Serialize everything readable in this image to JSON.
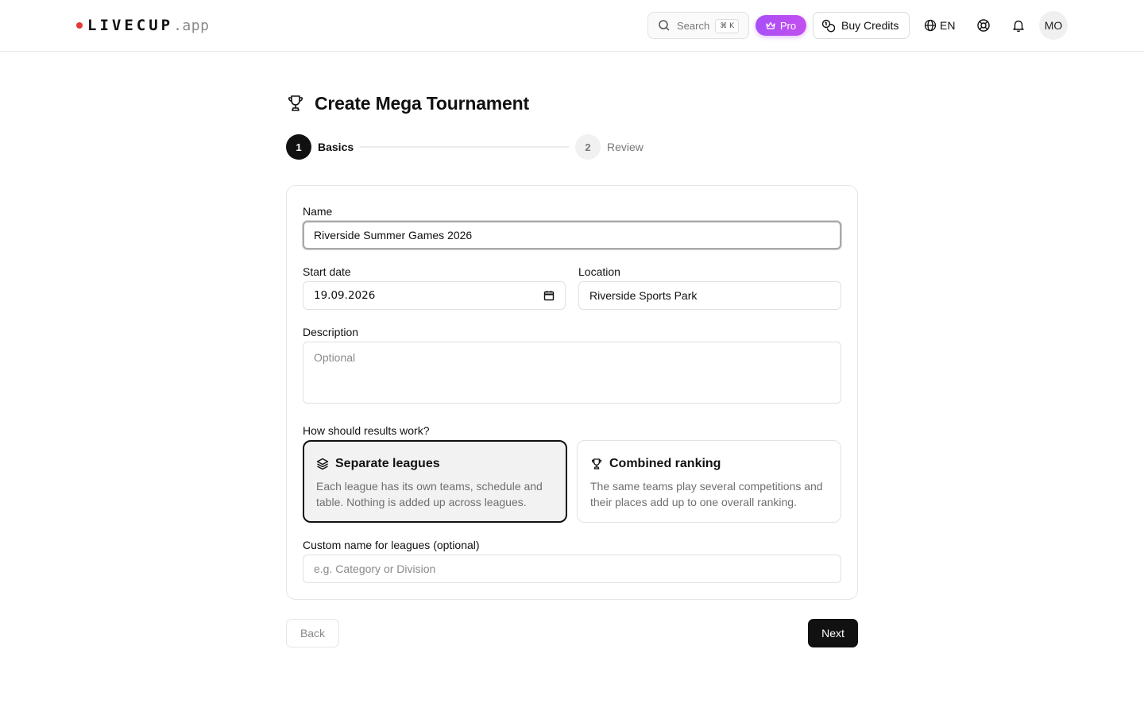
{
  "header": {
    "logo": {
      "brand": "LIVECUP",
      "suffix": ".app",
      "dot_color": "#e53935"
    },
    "search": {
      "label": "Search",
      "shortcut": "⌘ K",
      "icon": "search-icon"
    },
    "pro_badge": {
      "label": "Pro",
      "icon": "crown-icon",
      "color": "#b44ff4"
    },
    "buy_credits": {
      "label": "Buy Credits",
      "icon": "coins-icon"
    },
    "language": {
      "label": "EN",
      "icon": "globe-icon"
    },
    "help_icon": "lifebuoy-icon",
    "notifications_icon": "bell-icon",
    "avatar_initials": "MO"
  },
  "page": {
    "title": "Create Mega Tournament",
    "title_icon": "trophy-icon"
  },
  "stepper": {
    "steps": [
      {
        "number": "1",
        "label": "Basics",
        "active": true
      },
      {
        "number": "2",
        "label": "Review",
        "active": false
      }
    ]
  },
  "form": {
    "name": {
      "label": "Name",
      "value": "Riverside Summer Games 2026"
    },
    "start_date": {
      "label": "Start date",
      "value": "19.09.2026"
    },
    "location": {
      "label": "Location",
      "value": "Riverside Sports Park"
    },
    "description": {
      "label": "Description",
      "placeholder": "Optional"
    },
    "results_mode": {
      "label": "How should results work?",
      "options": [
        {
          "title": "Separate leagues",
          "icon": "layers-icon",
          "description": "Each league has its own teams, schedule and table. Nothing is added up across leagues.",
          "selected": true
        },
        {
          "title": "Combined ranking",
          "icon": "trophy-icon",
          "description": "The same teams play several competitions and their places add up to one overall ranking.",
          "selected": false
        }
      ]
    },
    "custom_league_name": {
      "label": "Custom name for leagues (optional)",
      "placeholder": "e.g. Category or Division"
    }
  },
  "actions": {
    "back_label": "Back",
    "next_label": "Next"
  }
}
